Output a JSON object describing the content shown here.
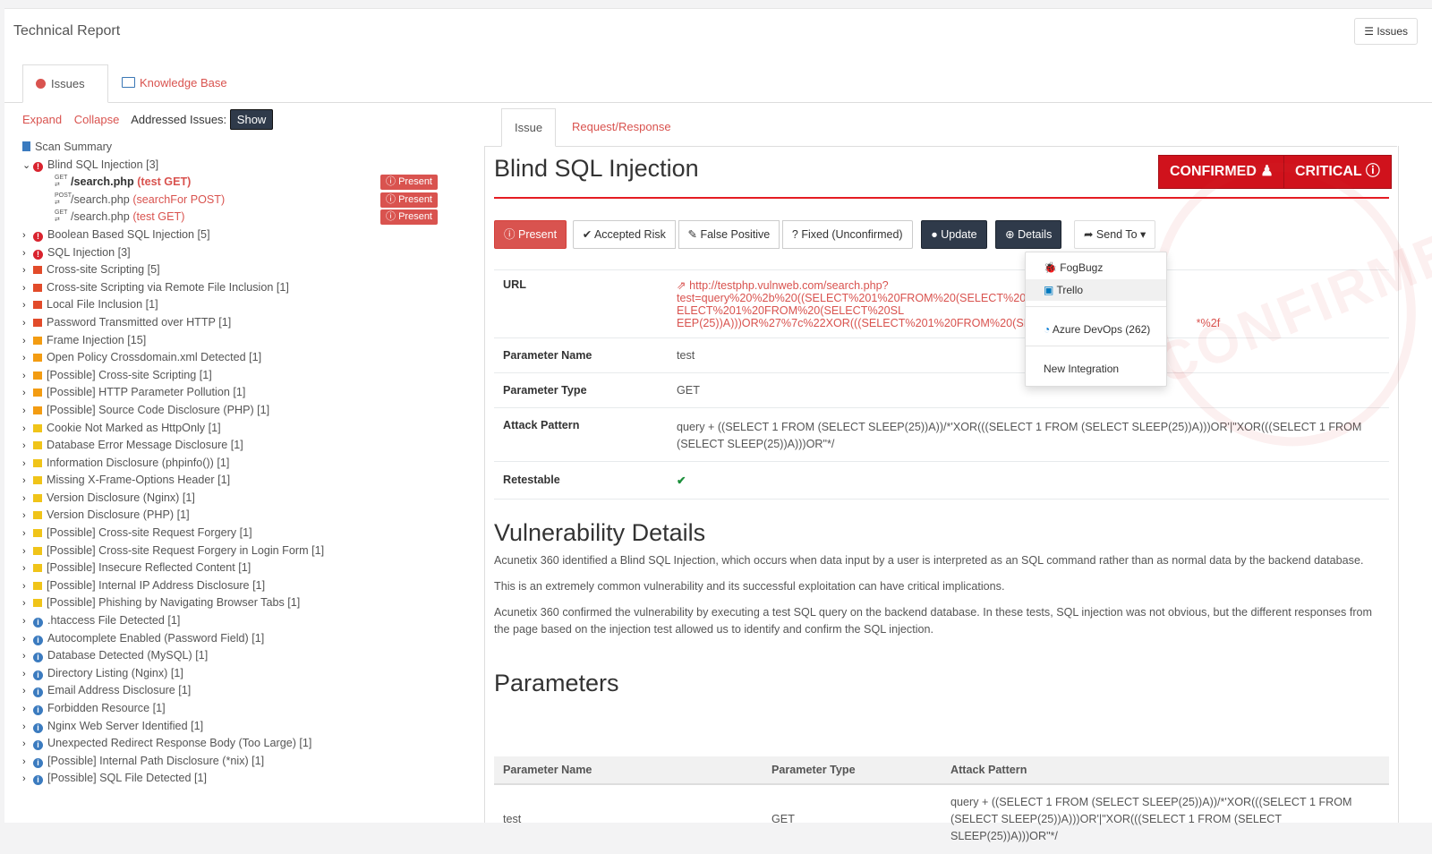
{
  "header": {
    "title": "Technical Report",
    "issues_button": "Issues"
  },
  "left_tabs": {
    "issues": "Issues",
    "kb": "Knowledge Base"
  },
  "left_toolbar": {
    "expand": "Expand",
    "collapse": "Collapse",
    "addressed": "Addressed Issues:",
    "show": "Show"
  },
  "tree": {
    "scan_summary": "Scan Summary",
    "blind": "Blind SQL Injection [3]",
    "children": [
      {
        "path": "/search.php",
        "param": "(test GET)",
        "badge": "Present"
      },
      {
        "path": "/search.php",
        "param": "(searchFor POST)",
        "badge": "Present"
      },
      {
        "path": "/search.php",
        "param": "(test GET)",
        "badge": "Present"
      }
    ],
    "items": [
      {
        "label": "Boolean Based SQL Injection [5]",
        "icon": "critical"
      },
      {
        "label": "SQL Injection [3]",
        "icon": "critical"
      },
      {
        "label": "Cross-site Scripting [5]",
        "icon": "flag-red"
      },
      {
        "label": "Cross-site Scripting via Remote File Inclusion [1]",
        "icon": "flag-red"
      },
      {
        "label": "Local File Inclusion [1]",
        "icon": "flag-red"
      },
      {
        "label": "Password Transmitted over HTTP [1]",
        "icon": "flag-red"
      },
      {
        "label": "Frame Injection [15]",
        "icon": "flag-orange"
      },
      {
        "label": "Open Policy Crossdomain.xml Detected [1]",
        "icon": "flag-orange"
      },
      {
        "label": "[Possible] Cross-site Scripting [1]",
        "icon": "flag-orange"
      },
      {
        "label": "[Possible] HTTP Parameter Pollution [1]",
        "icon": "flag-orange"
      },
      {
        "label": "[Possible] Source Code Disclosure (PHP) [1]",
        "icon": "flag-orange"
      },
      {
        "label": "Cookie Not Marked as HttpOnly [1]",
        "icon": "flag-yellow"
      },
      {
        "label": "Database Error Message Disclosure [1]",
        "icon": "flag-yellow"
      },
      {
        "label": "Information Disclosure (phpinfo()) [1]",
        "icon": "flag-yellow"
      },
      {
        "label": "Missing X-Frame-Options Header [1]",
        "icon": "flag-yellow"
      },
      {
        "label": "Version Disclosure (Nginx) [1]",
        "icon": "flag-yellow"
      },
      {
        "label": "Version Disclosure (PHP) [1]",
        "icon": "flag-yellow"
      },
      {
        "label": "[Possible] Cross-site Request Forgery [1]",
        "icon": "flag-yellow"
      },
      {
        "label": "[Possible] Cross-site Request Forgery in Login Form [1]",
        "icon": "flag-yellow"
      },
      {
        "label": "[Possible] Insecure Reflected Content [1]",
        "icon": "flag-yellow"
      },
      {
        "label": "[Possible] Internal IP Address Disclosure [1]",
        "icon": "flag-yellow"
      },
      {
        "label": "[Possible] Phishing by Navigating Browser Tabs [1]",
        "icon": "flag-yellow"
      },
      {
        "label": ".htaccess File Detected [1]",
        "icon": "info"
      },
      {
        "label": "Autocomplete Enabled (Password Field) [1]",
        "icon": "info"
      },
      {
        "label": "Database Detected (MySQL) [1]",
        "icon": "info"
      },
      {
        "label": "Directory Listing (Nginx) [1]",
        "icon": "info"
      },
      {
        "label": "Email Address Disclosure [1]",
        "icon": "info"
      },
      {
        "label": "Forbidden Resource [1]",
        "icon": "info"
      },
      {
        "label": "Nginx Web Server Identified [1]",
        "icon": "info"
      },
      {
        "label": "Unexpected Redirect Response Body (Too Large) [1]",
        "icon": "info"
      },
      {
        "label": "[Possible] Internal Path Disclosure (*nix) [1]",
        "icon": "info"
      },
      {
        "label": "[Possible] SQL File Detected [1]",
        "icon": "info"
      }
    ]
  },
  "right_tabs": {
    "issue": "Issue",
    "reqres": "Request/Response"
  },
  "issue": {
    "title": "Blind SQL Injection",
    "confirmed": "CONFIRMED",
    "critical": "CRITICAL",
    "buttons": {
      "present": "Present",
      "accepted": "Accepted Risk",
      "false_positive": "False Positive",
      "fixed": "Fixed (Unconfirmed)",
      "update": "Update",
      "details": "Details",
      "send_to": "Send To"
    },
    "details": {
      "url_label": "URL",
      "url_line1": "http://testphp.vulnweb.com/search.php?",
      "url_line2": "test=query%20%2b%20((SELECT%201%20FROM%20(SELECT%20SL",
      "url_line2b": "ELECT%201%20FROM%20(SELECT%20SL",
      "url_line3": "EEP(25))A)))OR%27%7c%22XOR(((SELECT%201%20FROM%20(SELEC",
      "url_line3b": "*%2f",
      "pname_label": "Parameter Name",
      "pname": "test",
      "ptype_label": "Parameter Type",
      "ptype": "GET",
      "attack_label": "Attack Pattern",
      "attack": "query + ((SELECT 1 FROM (SELECT SLEEP(25))A))/*'XOR(((SELECT 1 FROM (SELECT SLEEP(25))A)))OR'|\"XOR(((SELECT 1 FROM (SELECT SLEEP(25))A)))OR\"*/",
      "retestable_label": "Retestable"
    },
    "vuln_title": "Vulnerability Details",
    "vuln_p1": "Acunetix 360 identified a Blind SQL Injection, which occurs when data input by a user is interpreted as an SQL command rather than as normal data by the backend database.",
    "vuln_p2": "This is an extremely common vulnerability and its successful exploitation can have critical implications.",
    "vuln_p3": "Acunetix 360 confirmed the vulnerability by executing a test SQL query on the backend database. In these tests, SQL injection was not obvious, but the different responses from the page based on the injection test allowed us to identify and confirm the SQL injection.",
    "params_title": "Parameters",
    "params_headers": {
      "name": "Parameter Name",
      "type": "Parameter Type",
      "pattern": "Attack Pattern"
    },
    "params_row": {
      "name": "test",
      "type": "GET",
      "pattern": "query + ((SELECT 1 FROM (SELECT SLEEP(25))A))/*'XOR(((SELECT 1 FROM (SELECT SLEEP(25))A)))OR'|\"XOR(((SELECT 1 FROM (SELECT SLEEP(25))A)))OR\"*/"
    }
  },
  "send_menu": {
    "fogbugz": "FogBugz",
    "trello": "Trello",
    "azure": "Azure DevOps (262)",
    "new": "New Integration"
  },
  "stamp": "CONFIRMED"
}
